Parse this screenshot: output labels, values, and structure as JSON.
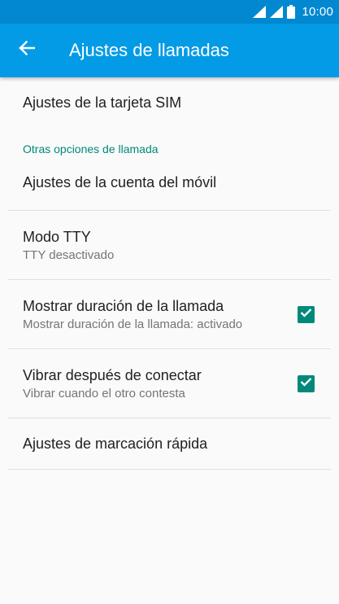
{
  "status_bar": {
    "time": "10:00",
    "icons": [
      "signal-icon",
      "signal-icon",
      "battery-icon"
    ]
  },
  "app_bar": {
    "back_icon": "arrow-back-icon",
    "title": "Ajustes de llamadas"
  },
  "settings": {
    "sim_settings": {
      "title": "Ajustes de la tarjeta SIM"
    },
    "category": "Otras opciones de llamada",
    "mobile_account": {
      "title": "Ajustes de la cuenta del móvil"
    },
    "tty_mode": {
      "title": "Modo TTY",
      "summary": "TTY desactivado"
    },
    "show_call_duration": {
      "title": "Mostrar duración de la llamada",
      "summary": "Mostrar duración de la llamada: activado",
      "checked": true
    },
    "vibrate_after_connect": {
      "title": "Vibrar después de conectar",
      "summary": "Vibrar cuando el otro contesta",
      "checked": true
    },
    "speed_dial": {
      "title": "Ajustes de marcación rápida"
    }
  },
  "colors": {
    "status_bar": "#0288d1",
    "app_bar": "#039be5",
    "accent": "#00897b",
    "background": "#fafafa"
  }
}
